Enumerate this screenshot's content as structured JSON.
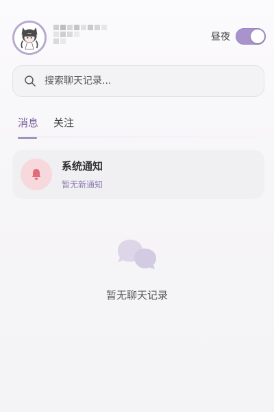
{
  "header": {
    "avatar_alt": "user avatar",
    "username_obscured": true,
    "night_mode": {
      "label": "昼夜",
      "enabled": true
    }
  },
  "search": {
    "placeholder": "搜索聊天记录..."
  },
  "tabs": [
    {
      "label": "消息",
      "active": true
    },
    {
      "label": "关注",
      "active": false
    }
  ],
  "notification": {
    "title": "系统通知",
    "subtitle": "暂无新通知",
    "icon": "bell-icon"
  },
  "empty_state": {
    "icon": "chat-bubbles-icon",
    "text": "暂无聊天记录"
  },
  "colors": {
    "accent": "#a893cc",
    "accent_text": "#7a64a3",
    "bell_bg": "#f7d8dc",
    "bell": "#e26c77",
    "chat_icon": "#d9d3e7"
  }
}
